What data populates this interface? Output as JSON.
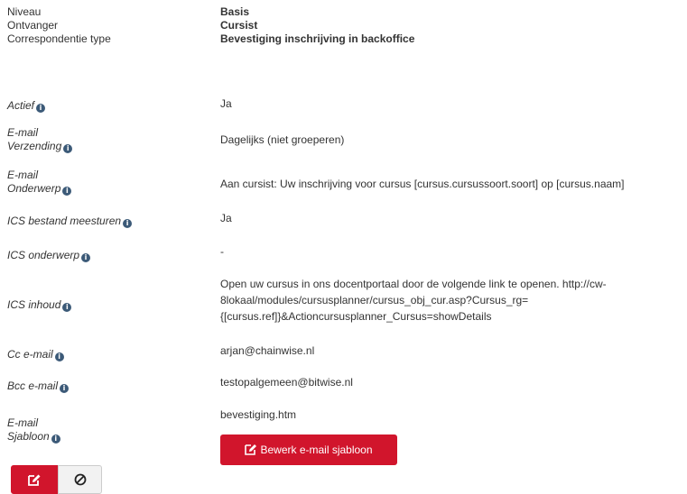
{
  "header": {
    "rows": [
      {
        "label": "Niveau",
        "value": "Basis"
      },
      {
        "label": "Ontvanger",
        "value": "Cursist"
      },
      {
        "label": "Correspondentie type",
        "value": "Bevestiging inschrijving in backoffice"
      }
    ]
  },
  "details": {
    "actief": {
      "label": "Actief",
      "value": "Ja"
    },
    "verzending": {
      "label_line1": "E-mail",
      "label_line2": "Verzending",
      "value": "Dagelijks (niet groeperen)"
    },
    "onderwerp": {
      "label_line1": "E-mail",
      "label_line2": "Onderwerp",
      "value": "Aan cursist: Uw inschrijving voor cursus [cursus.cursussoort.soort] op [cursus.naam]"
    },
    "ics_bestand": {
      "label": "ICS bestand meesturen",
      "value": "Ja"
    },
    "ics_onderwerp": {
      "label": "ICS onderwerp",
      "value": "-"
    },
    "ics_inhoud": {
      "label": "ICS inhoud",
      "value_lines": [
        "Open uw cursus in ons docentportaal door de volgende link te openen. http://cw-",
        "8lokaal/modules/cursusplanner/cursus_obj_cur.asp?Cursus_rg=",
        "{[cursus.ref]}&Actioncursusplanner_Cursus=showDetails"
      ]
    },
    "cc": {
      "label": "Cc e-mail",
      "value": "arjan@chainwise.nl"
    },
    "bcc": {
      "label": "Bcc e-mail",
      "value": "testopalgemeen@bitwise.nl"
    },
    "sjabloon": {
      "label_line1": "E-mail",
      "label_line2": "Sjabloon",
      "value": "bevestiging.htm",
      "button_label": "Bewerk e-mail sjabloon"
    }
  },
  "info_glyph": "i",
  "icons": {
    "info": "info-circle-icon",
    "edit": "edit-icon",
    "cancel": "ban-icon"
  },
  "colors": {
    "primary_red": "#d1152c",
    "info_icon": "#3c5a78",
    "text": "#333333",
    "secondary_button_bg": "#f2f2f2"
  }
}
